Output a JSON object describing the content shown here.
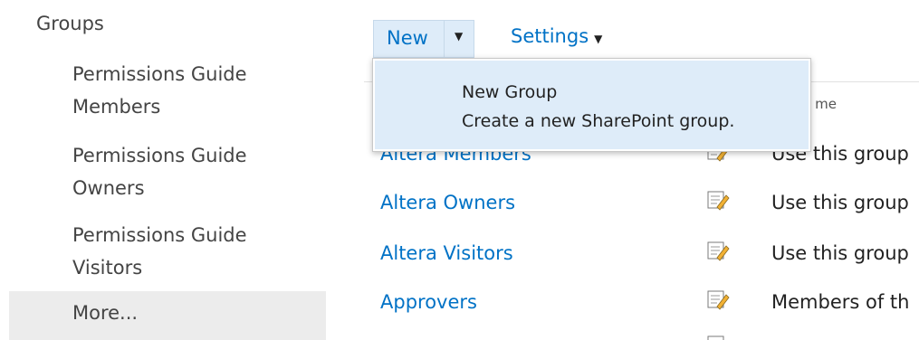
{
  "nav": {
    "heading": "Groups",
    "items": [
      {
        "line1": "Permissions Guide",
        "line2": "Members"
      },
      {
        "line1": "Permissions Guide",
        "line2": "Owners"
      },
      {
        "line1": "Permissions Guide",
        "line2": "Visitors"
      }
    ],
    "more": "More..."
  },
  "toolbar": {
    "new_label": "New",
    "new_dropdown_glyph": "▼",
    "settings_label": "Settings",
    "settings_caret": "▼"
  },
  "menu": {
    "title": "New Group",
    "description": "Create a new SharePoint group."
  },
  "table": {
    "about_header_partial": "ut me",
    "rows": [
      {
        "name": "Altera Members",
        "about": "Use this group"
      },
      {
        "name": "Altera Owners",
        "about": "Use this group"
      },
      {
        "name": "Altera Visitors",
        "about": "Use this group"
      },
      {
        "name": "Approvers",
        "about": "Members of th"
      }
    ],
    "edit_icon": "edit-pencil-icon"
  },
  "colors": {
    "link": "#0072c6",
    "button_bg": "#deecf9",
    "nav_highlight": "#ececec"
  }
}
